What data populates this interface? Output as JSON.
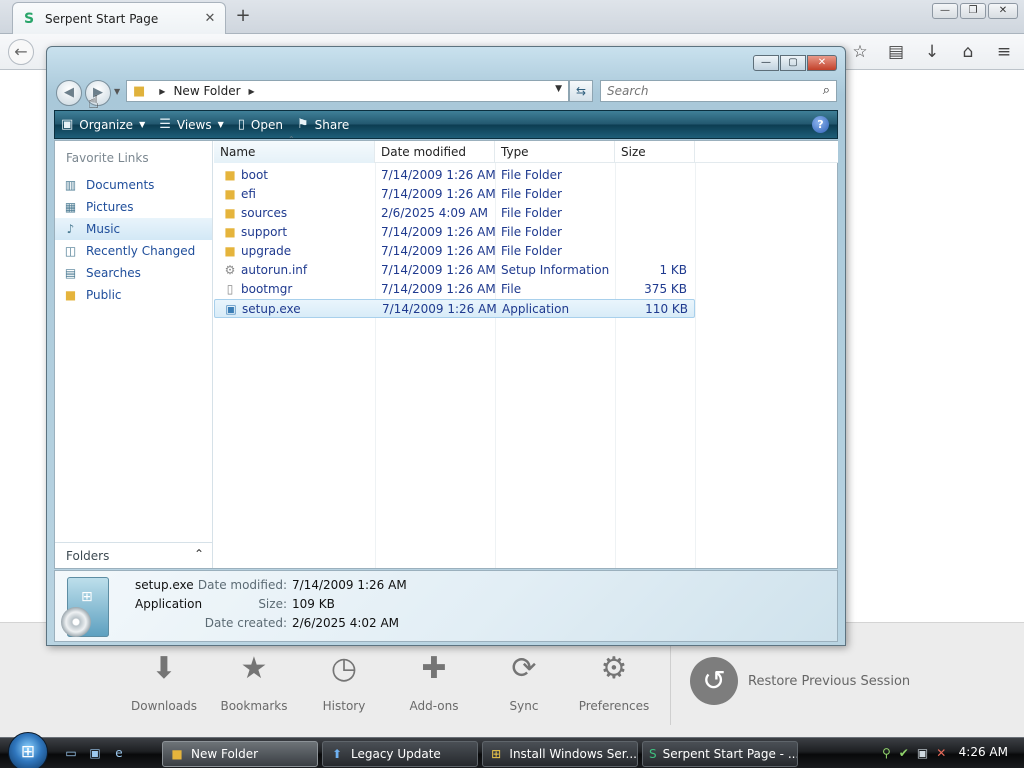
{
  "browser": {
    "tab_title": "Serpent Start Page",
    "tab_close": "✕",
    "new_tab": "+"
  },
  "explorer": {
    "address_path": "New Folder",
    "search_placeholder": "Search",
    "toolbar": {
      "organize": "Organize",
      "views": "Views",
      "open": "Open",
      "share": "Share"
    },
    "nav": {
      "title": "Favorite Links",
      "items": [
        {
          "label": "Documents",
          "selected": false
        },
        {
          "label": "Pictures",
          "selected": false
        },
        {
          "label": "Music",
          "selected": true
        },
        {
          "label": "Recently Changed",
          "selected": false
        },
        {
          "label": "Searches",
          "selected": false
        },
        {
          "label": "Public",
          "selected": false
        }
      ],
      "folders_label": "Folders"
    },
    "columns": {
      "name": "Name",
      "date": "Date modified",
      "type": "Type",
      "size": "Size"
    },
    "files": [
      {
        "name": "boot",
        "date": "7/14/2009 1:26 AM",
        "type": "File Folder",
        "size": "",
        "icon": "folder-icon"
      },
      {
        "name": "efi",
        "date": "7/14/2009 1:26 AM",
        "type": "File Folder",
        "size": "",
        "icon": "folder-icon"
      },
      {
        "name": "sources",
        "date": "2/6/2025 4:09 AM",
        "type": "File Folder",
        "size": "",
        "icon": "folder-icon"
      },
      {
        "name": "support",
        "date": "7/14/2009 1:26 AM",
        "type": "File Folder",
        "size": "",
        "icon": "folder-icon"
      },
      {
        "name": "upgrade",
        "date": "7/14/2009 1:26 AM",
        "type": "File Folder",
        "size": "",
        "icon": "folder-icon"
      },
      {
        "name": "autorun.inf",
        "date": "7/14/2009 1:26 AM",
        "type": "Setup Information",
        "size": "1 KB",
        "icon": "setup-info-icon"
      },
      {
        "name": "bootmgr",
        "date": "7/14/2009 1:26 AM",
        "type": "File",
        "size": "375 KB",
        "icon": "file-icon"
      },
      {
        "name": "setup.exe",
        "date": "7/14/2009 1:26 AM",
        "type": "Application",
        "size": "110 KB",
        "icon": "application-icon",
        "selected": true
      }
    ],
    "details": {
      "name": "setup.exe",
      "type": "Application",
      "date_modified_label": "Date modified:",
      "date_modified": "7/14/2009 1:26 AM",
      "size_label": "Size:",
      "size": "109 KB",
      "date_created_label": "Date created:",
      "date_created": "2/6/2025 4:02 AM"
    }
  },
  "launcher": {
    "items": [
      {
        "label": "Downloads",
        "icon": "download-icon"
      },
      {
        "label": "Bookmarks",
        "icon": "star-icon"
      },
      {
        "label": "History",
        "icon": "clock-icon"
      },
      {
        "label": "Add-ons",
        "icon": "puzzle-icon"
      },
      {
        "label": "Sync",
        "icon": "sync-icon"
      },
      {
        "label": "Preferences",
        "icon": "gear-icon"
      }
    ],
    "restore_session": "Restore Previous Session"
  },
  "taskbar": {
    "tasks": [
      {
        "label": "New Folder",
        "active": true,
        "icon": "folder-icon"
      },
      {
        "label": "Legacy Update",
        "active": false,
        "icon": "update-icon"
      },
      {
        "label": "Install Windows Ser...",
        "active": false,
        "icon": "windows-icon"
      },
      {
        "label": "Serpent Start Page - ...",
        "active": false,
        "icon": "serpent-icon"
      }
    ],
    "clock": "4:26 AM"
  }
}
